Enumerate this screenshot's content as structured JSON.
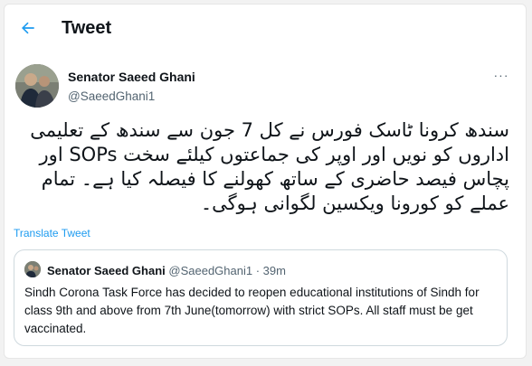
{
  "header": {
    "title": "Tweet",
    "back_icon": "back-arrow-icon"
  },
  "tweet": {
    "author_name": "Senator Saeed Ghani",
    "author_handle": "@SaeedGhani1",
    "more_icon": "more-dots-icon",
    "more_label": "···",
    "text": "سندھ کرونا ٹاسک فورس نے کل 7 جون سے سندھ کے تعلیمی اداروں کو نویں اور اوپر کی جماعتوں کیلئے سخت SOPs اور پچاس فیصد حاضری کے ساتھ کھولنے کا فیصلہ کیا ہے۔ تمام عملے کو کورونا ویکسین لگوانی ہوگی۔",
    "translate_label": "Translate Tweet"
  },
  "quoted": {
    "author_name": "Senator Saeed Ghani",
    "author_handle": "@SaeedGhani1",
    "separator": " · ",
    "time": "39m",
    "text": "Sindh Corona Task Force has decided to reopen educational institutions of Sindh for class 9th and above from 7th June(tomorrow) with strict SOPs. All staff must be get vaccinated."
  },
  "colors": {
    "accent": "#1d9bf0",
    "text": "#0f1419",
    "muted": "#536471",
    "border": "#cfd9de"
  }
}
